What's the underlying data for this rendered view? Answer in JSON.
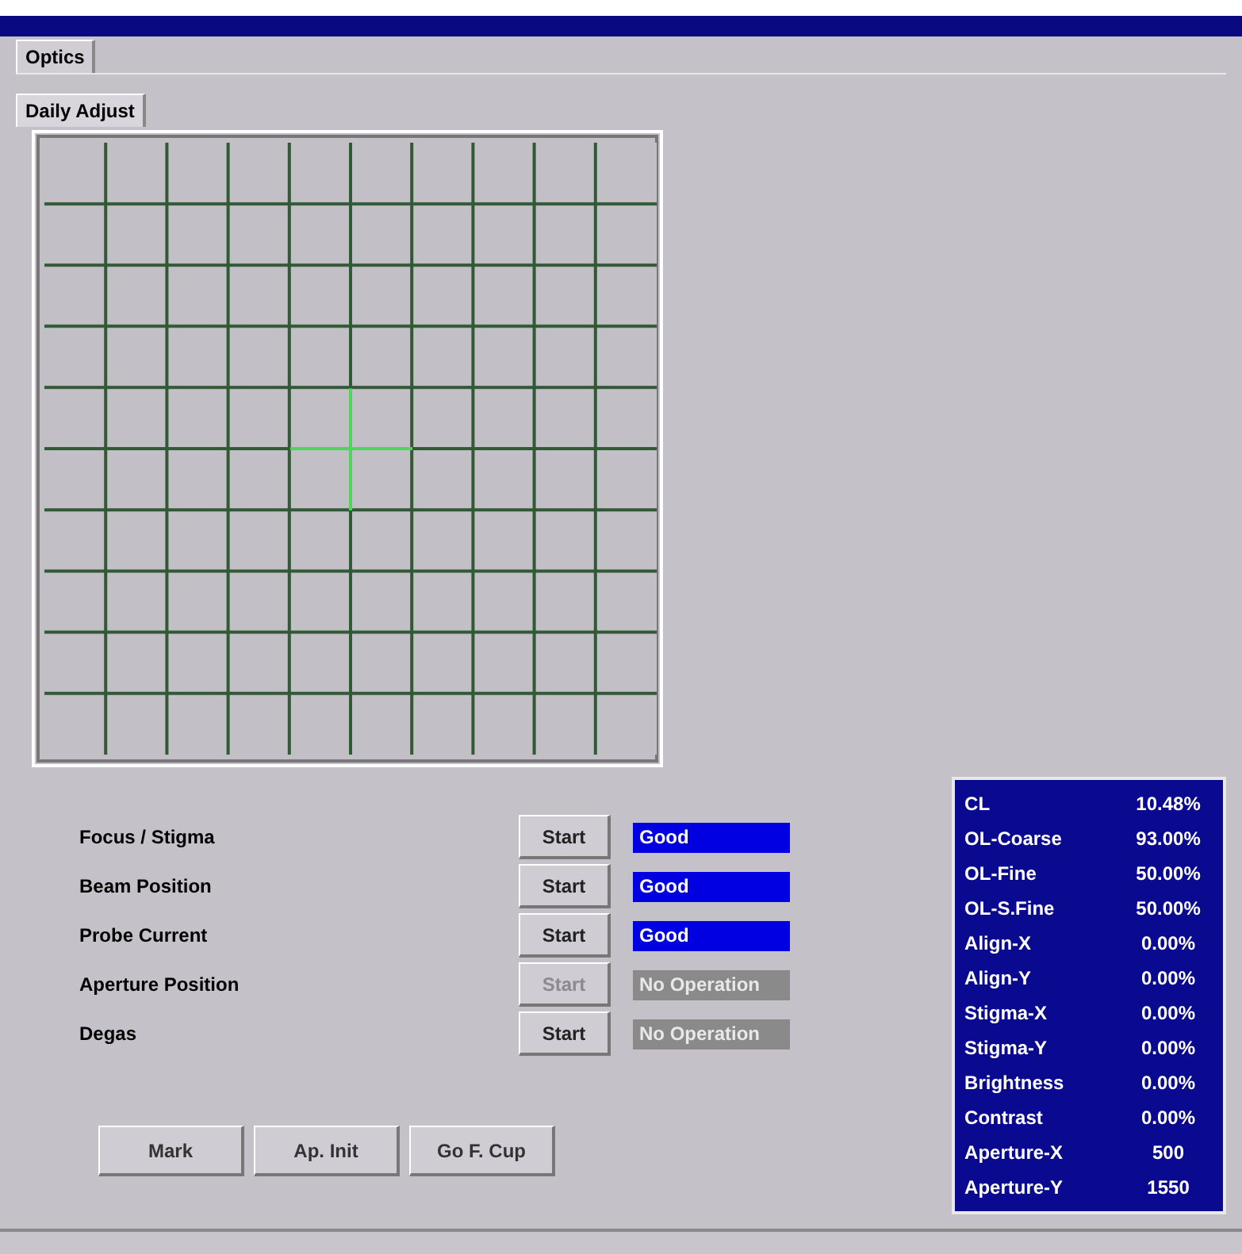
{
  "tabs": [
    {
      "label": "Optics",
      "selected": true
    }
  ],
  "subtabs": [
    {
      "label": "Daily Adjust",
      "selected": true
    }
  ],
  "operations": [
    {
      "label": "Focus / Stigma",
      "button": "Start",
      "disabled": false,
      "status": "Good",
      "kind": "good"
    },
    {
      "label": "Beam Position",
      "button": "Start",
      "disabled": false,
      "status": "Good",
      "kind": "good"
    },
    {
      "label": "Probe Current",
      "button": "Start",
      "disabled": false,
      "status": "Good",
      "kind": "good"
    },
    {
      "label": "Aperture Position",
      "button": "Start",
      "disabled": true,
      "status": "No Operation",
      "kind": "idle"
    },
    {
      "label": "Degas",
      "button": "Start",
      "disabled": false,
      "status": "No Operation",
      "kind": "idle"
    }
  ],
  "buttons": [
    "Mark",
    "Ap. Init",
    "Go F. Cup"
  ],
  "readouts": [
    {
      "name": "CL",
      "value": "10.48%"
    },
    {
      "name": "OL-Coarse",
      "value": "93.00%"
    },
    {
      "name": "OL-Fine",
      "value": "50.00%"
    },
    {
      "name": "OL-S.Fine",
      "value": "50.00%"
    },
    {
      "name": "Align-X",
      "value": "0.00%"
    },
    {
      "name": "Align-Y",
      "value": "0.00%"
    },
    {
      "name": "Stigma-X",
      "value": "0.00%"
    },
    {
      "name": "Stigma-Y",
      "value": "0.00%"
    },
    {
      "name": "Brightness",
      "value": "0.00%"
    },
    {
      "name": "Contrast",
      "value": "0.00%"
    },
    {
      "name": "Aperture-X",
      "value": "500"
    },
    {
      "name": "Aperture-Y",
      "value": "1550"
    }
  ]
}
